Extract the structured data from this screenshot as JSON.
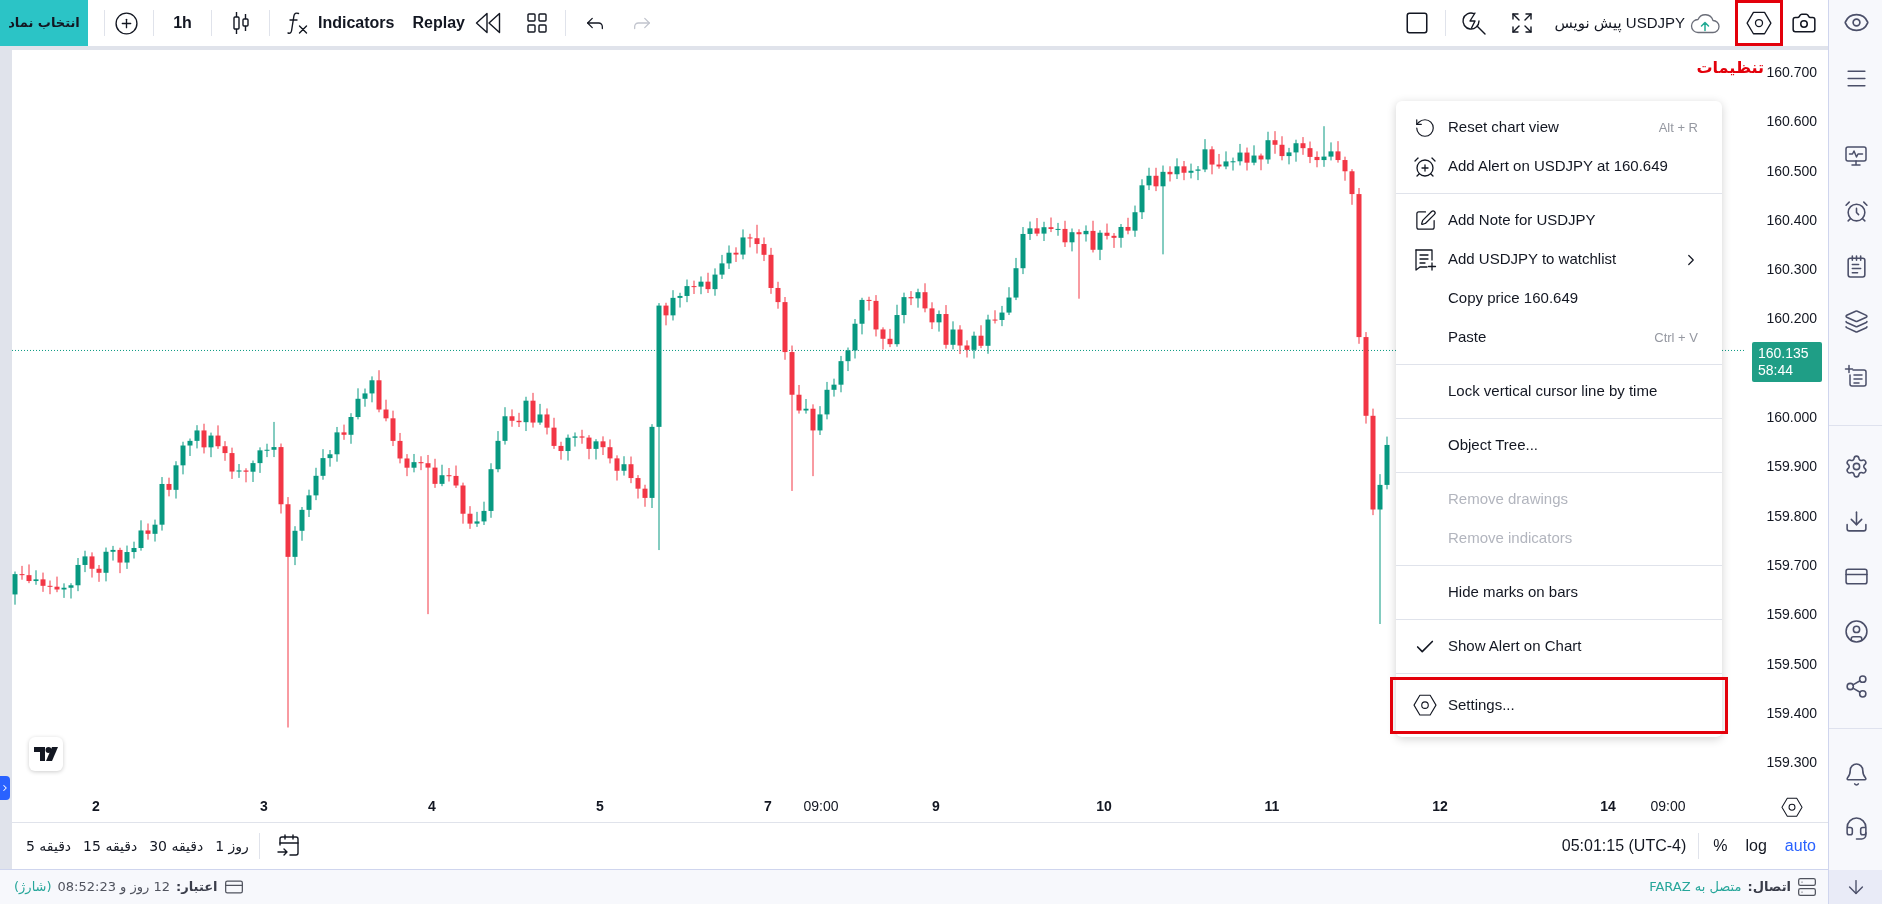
{
  "toolbar": {
    "symbol_button": "انتخاب نماد",
    "interval": "1h",
    "indicators": "Indicators",
    "replay": "Replay",
    "undo": {
      "disabled": false
    },
    "redo": {
      "disabled": true
    },
    "layout_name": "USDJPY پیش نویس",
    "settings_button": {
      "highlighted": true
    }
  },
  "annotation": {
    "text": "تنظیمات"
  },
  "price_axis": {
    "items": [
      {
        "kind": "tick",
        "label": "160.700"
      },
      {
        "kind": "tick",
        "label": "160.600"
      },
      {
        "kind": "tick",
        "label": "160.500"
      },
      {
        "kind": "tick",
        "label": "160.400"
      },
      {
        "kind": "tick",
        "label": "160.300"
      },
      {
        "kind": "tick",
        "label": "160.200"
      },
      {
        "kind": "price_tag",
        "price": "160.135",
        "countdown": "58:44"
      },
      {
        "kind": "tick",
        "label": "160.000"
      },
      {
        "kind": "tick",
        "label": "159.900"
      },
      {
        "kind": "tick",
        "label": "159.800"
      },
      {
        "kind": "tick",
        "label": "159.700"
      },
      {
        "kind": "tick",
        "label": "159.600"
      },
      {
        "kind": "tick",
        "label": "159.500"
      },
      {
        "kind": "tick",
        "label": "159.400"
      },
      {
        "kind": "tick",
        "label": "159.300"
      }
    ]
  },
  "time_axis": {
    "labels": [
      {
        "kind": "day",
        "label": "2"
      },
      {
        "kind": "day",
        "label": "3"
      },
      {
        "kind": "day",
        "label": "4"
      },
      {
        "kind": "day",
        "label": "5"
      },
      {
        "kind": "day",
        "label": "7"
      },
      {
        "kind": "time",
        "label": "09:00"
      },
      {
        "kind": "day",
        "label": "9"
      },
      {
        "kind": "day",
        "label": "10"
      },
      {
        "kind": "day",
        "label": "11"
      },
      {
        "kind": "day",
        "label": "12"
      },
      {
        "kind": "day",
        "label": "14"
      },
      {
        "kind": "time",
        "label": "09:00"
      }
    ]
  },
  "context_menu": {
    "sections": [
      [
        {
          "label": "Reset chart view",
          "shortcut": "Alt + R",
          "disabled": false,
          "checked": false,
          "submenu": false,
          "highlighted": false
        },
        {
          "label": "Add Alert on USDJPY at 160.649",
          "disabled": false,
          "checked": false,
          "submenu": false,
          "highlighted": false
        }
      ],
      [
        {
          "label": "Add Note for USDJPY",
          "disabled": false,
          "checked": false,
          "submenu": false,
          "highlighted": false
        },
        {
          "label": "Add USDJPY to watchlist",
          "disabled": false,
          "checked": false,
          "submenu": true,
          "highlighted": false
        },
        {
          "label": "Copy price 160.649",
          "disabled": false,
          "checked": false,
          "submenu": false,
          "highlighted": false
        },
        {
          "label": "Paste",
          "shortcut": "Ctrl + V",
          "disabled": false,
          "checked": false,
          "submenu": false,
          "highlighted": false
        }
      ],
      [
        {
          "label": "Lock vertical cursor line by time",
          "disabled": false,
          "checked": false,
          "submenu": false,
          "highlighted": false
        }
      ],
      [
        {
          "label": "Object Tree...",
          "disabled": false,
          "checked": false,
          "submenu": false,
          "highlighted": false
        }
      ],
      [
        {
          "label": "Remove drawings",
          "disabled": true,
          "checked": false,
          "submenu": false,
          "highlighted": false
        },
        {
          "label": "Remove indicators",
          "disabled": true,
          "checked": false,
          "submenu": false,
          "highlighted": false
        }
      ],
      [
        {
          "label": "Hide marks on bars",
          "disabled": false,
          "checked": false,
          "submenu": false,
          "highlighted": false
        }
      ],
      [
        {
          "label": "Show Alert on Chart",
          "disabled": false,
          "checked": true,
          "submenu": false,
          "highlighted": false
        }
      ],
      [
        {
          "label": "Settings...",
          "disabled": false,
          "checked": false,
          "submenu": false,
          "highlighted": true
        }
      ]
    ]
  },
  "bottom_bar": {
    "ranges": [
      "1 روز",
      "30 دقیقه",
      "15 دقیقه",
      "5 دقیقه"
    ],
    "clock": "05:01:15 (UTC-4)",
    "scale_modes": [
      {
        "label": "%",
        "selected": false
      },
      {
        "label": "log",
        "selected": false
      },
      {
        "label": "auto",
        "selected": true
      }
    ]
  },
  "status_bar": {
    "credit": {
      "label": "اعتبار:",
      "value": "12 روز و 08:52:23",
      "action": "(شارژ)"
    },
    "connection": {
      "label": "اتصال:",
      "value": "متصل به FARAZ"
    }
  }
}
